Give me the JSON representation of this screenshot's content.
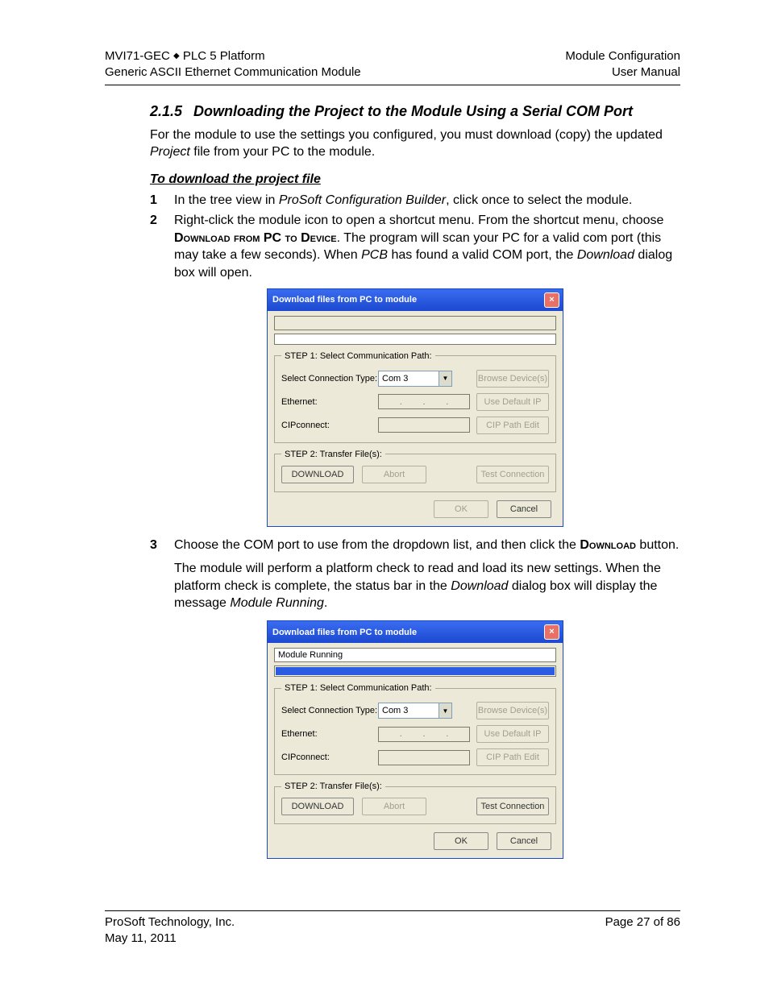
{
  "page": {
    "header_left_line1_a": "MVI71-GEC",
    "header_left_line1_b": "PLC 5 Platform",
    "header_left_line2": "Generic ASCII Ethernet Communication Module",
    "header_right_line1": "Module Configuration",
    "header_right_line2": "User Manual",
    "section_number": "2.1.5",
    "section_title": "Downloading the Project to the Module Using a Serial COM Port",
    "intro_a": "For the module to use the settings you configured, you must download (copy) the updated ",
    "intro_b_it": "Project",
    "intro_c": " file from your PC to the module.",
    "subhead": "To download the project file",
    "step1_a": "In the tree view in ",
    "step1_b_it": "ProSoft Configuration Builder",
    "step1_c": ", click once to select the module.",
    "step2_a": "Right-click the module icon to open a shortcut menu. From the shortcut menu, choose ",
    "step2_b_sc": "Download from PC to Device",
    "step2_c": ". The program will scan your PC for a valid com port (this may take a few seconds). When ",
    "step2_d_it": "PCB",
    "step2_e": " has found a valid COM port, the ",
    "step2_f_it": "Download",
    "step2_g": " dialog box will open.",
    "step3_a": "Choose the COM port to use from the dropdown list, and then click the ",
    "step3_b_sc": "Download",
    "step3_c": " button.",
    "post3_a": "The module will perform a platform check to read and load its new settings. When the platform check is complete, the status bar in the ",
    "post3_b_it": "Download",
    "post3_c": " dialog box will display the message ",
    "post3_d_it": "Module Running",
    "post3_e": ".",
    "footer_left_line1": "ProSoft Technology, Inc.",
    "footer_left_line2": "May 11, 2011",
    "footer_right": "Page 27 of 86"
  },
  "dlg": {
    "title": "Download files from PC to module",
    "status_empty": "",
    "status_running": "Module Running",
    "group1_legend": "STEP 1: Select Communication Path:",
    "lbl_conn_type": "Select Connection Type:",
    "combo_value": "Com 3",
    "btn_browse": "Browse Device(s)",
    "lbl_ethernet": "Ethernet:",
    "btn_useip": "Use Default IP",
    "lbl_cipconnect": "CIPconnect:",
    "btn_cip": "CIP Path Edit",
    "group2_legend": "STEP 2: Transfer File(s):",
    "btn_download": "DOWNLOAD",
    "btn_abort": "Abort",
    "btn_test": "Test Connection",
    "btn_ok": "OK",
    "btn_cancel": "Cancel"
  }
}
